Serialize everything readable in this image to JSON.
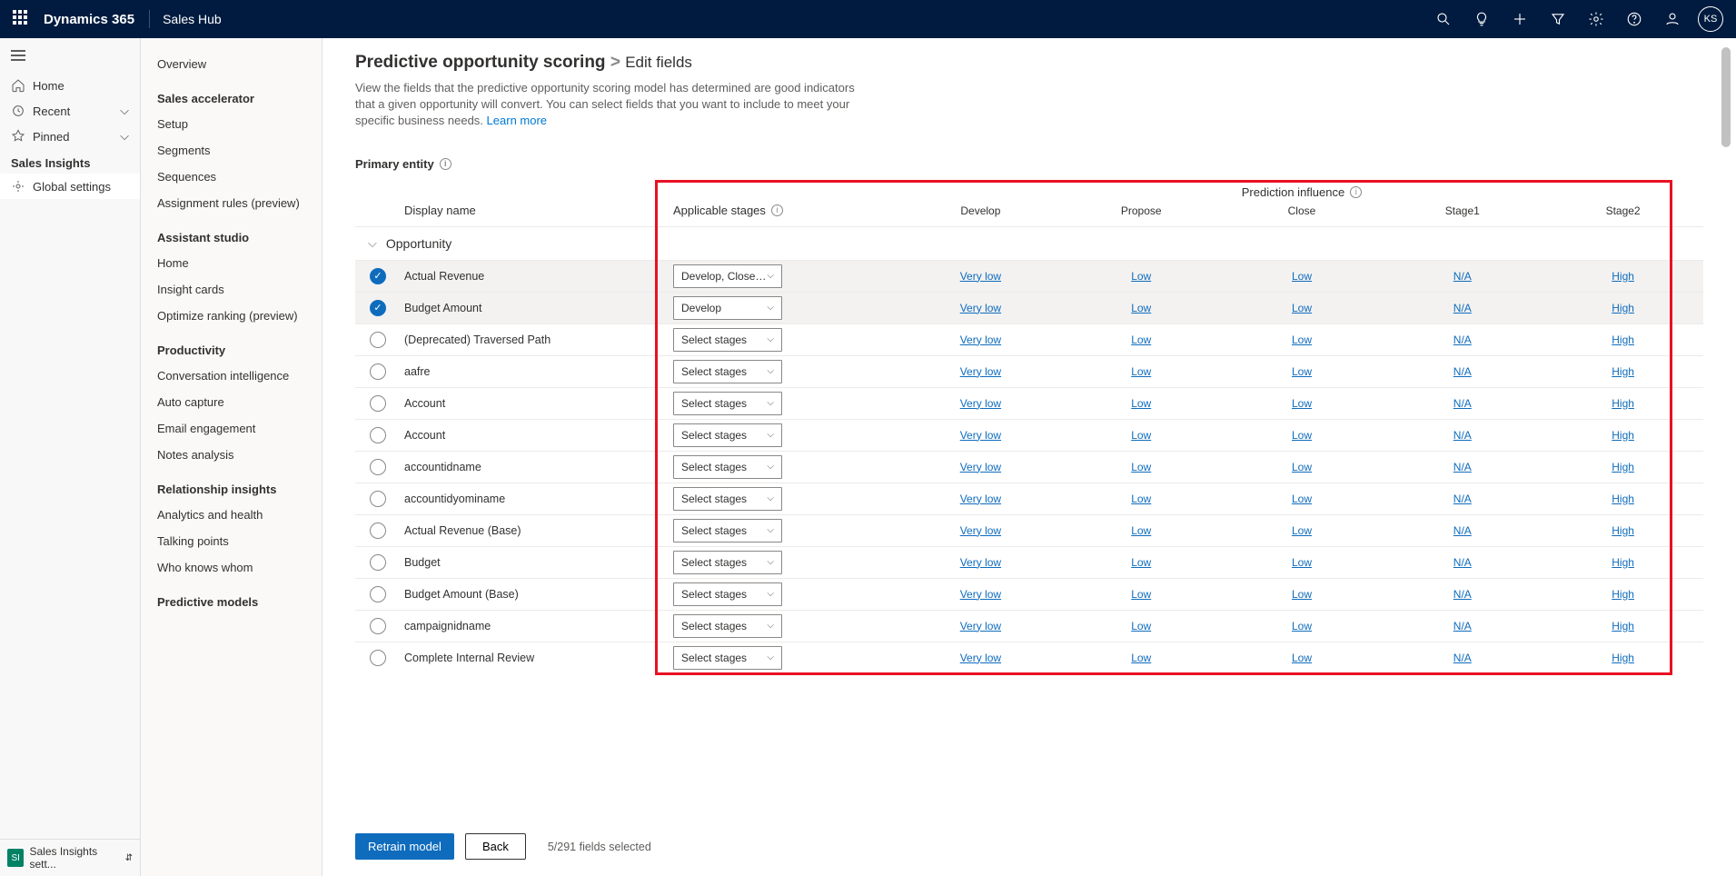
{
  "topbar": {
    "brand": "Dynamics 365",
    "app": "Sales Hub",
    "avatar": "KS"
  },
  "leftnav": {
    "home": "Home",
    "recent": "Recent",
    "pinned": "Pinned",
    "section": "Sales Insights",
    "global": "Global settings",
    "bottom_label": "Sales Insights sett...",
    "bottom_badge": "SI"
  },
  "subnav": {
    "overview": "Overview",
    "g1": "Sales accelerator",
    "g1_items": [
      "Setup",
      "Segments",
      "Sequences",
      "Assignment rules (preview)"
    ],
    "g2": "Assistant studio",
    "g2_items": [
      "Home",
      "Insight cards",
      "Optimize ranking (preview)"
    ],
    "g3": "Productivity",
    "g3_items": [
      "Conversation intelligence",
      "Auto capture",
      "Email engagement",
      "Notes analysis"
    ],
    "g4": "Relationship insights",
    "g4_items": [
      "Analytics and health",
      "Talking points",
      "Who knows whom"
    ],
    "g5": "Predictive models"
  },
  "page": {
    "title": "Predictive opportunity scoring",
    "crumb": "Edit fields",
    "desc": "View the fields that the predictive opportunity scoring model has determined are good indicators that a given opportunity will convert. You can select fields that you want to include to meet your specific business needs.",
    "learn": "Learn more",
    "primary_entity": "Primary entity"
  },
  "columns": {
    "display_name": "Display name",
    "applicable_stages": "Applicable stages",
    "prediction_influence": "Prediction influence",
    "stages": [
      "Develop",
      "Propose",
      "Close",
      "Stage1",
      "Stage2"
    ]
  },
  "group": "Opportunity",
  "select_placeholder": "Select stages",
  "rows": [
    {
      "checked": true,
      "name": "Actual Revenue",
      "stage": "Develop, Close, …",
      "infl": [
        "Very low",
        "Low",
        "Low",
        "N/A",
        "High"
      ]
    },
    {
      "checked": true,
      "name": "Budget Amount",
      "stage": "Develop",
      "infl": [
        "Very low",
        "Low",
        "Low",
        "N/A",
        "High"
      ]
    },
    {
      "checked": false,
      "name": "(Deprecated) Traversed Path",
      "stage": "Select stages",
      "infl": [
        "Very low",
        "Low",
        "Low",
        "N/A",
        "High"
      ]
    },
    {
      "checked": false,
      "name": "aafre",
      "stage": "Select stages",
      "infl": [
        "Very low",
        "Low",
        "Low",
        "N/A",
        "High"
      ]
    },
    {
      "checked": false,
      "name": "Account",
      "stage": "Select stages",
      "infl": [
        "Very low",
        "Low",
        "Low",
        "N/A",
        "High"
      ]
    },
    {
      "checked": false,
      "name": "Account",
      "stage": "Select stages",
      "infl": [
        "Very low",
        "Low",
        "Low",
        "N/A",
        "High"
      ]
    },
    {
      "checked": false,
      "name": "accountidname",
      "stage": "Select stages",
      "infl": [
        "Very low",
        "Low",
        "Low",
        "N/A",
        "High"
      ]
    },
    {
      "checked": false,
      "name": "accountidyominame",
      "stage": "Select stages",
      "infl": [
        "Very low",
        "Low",
        "Low",
        "N/A",
        "High"
      ]
    },
    {
      "checked": false,
      "name": "Actual Revenue (Base)",
      "stage": "Select stages",
      "infl": [
        "Very low",
        "Low",
        "Low",
        "N/A",
        "High"
      ]
    },
    {
      "checked": false,
      "name": "Budget",
      "stage": "Select stages",
      "infl": [
        "Very low",
        "Low",
        "Low",
        "N/A",
        "High"
      ]
    },
    {
      "checked": false,
      "name": "Budget Amount (Base)",
      "stage": "Select stages",
      "infl": [
        "Very low",
        "Low",
        "Low",
        "N/A",
        "High"
      ]
    },
    {
      "checked": false,
      "name": "campaignidname",
      "stage": "Select stages",
      "infl": [
        "Very low",
        "Low",
        "Low",
        "N/A",
        "High"
      ]
    },
    {
      "checked": false,
      "name": "Complete Internal Review",
      "stage": "Select stages",
      "infl": [
        "Very low",
        "Low",
        "Low",
        "N/A",
        "High"
      ]
    }
  ],
  "footer": {
    "retrain": "Retrain model",
    "back": "Back",
    "count": "5/291 fields selected"
  }
}
